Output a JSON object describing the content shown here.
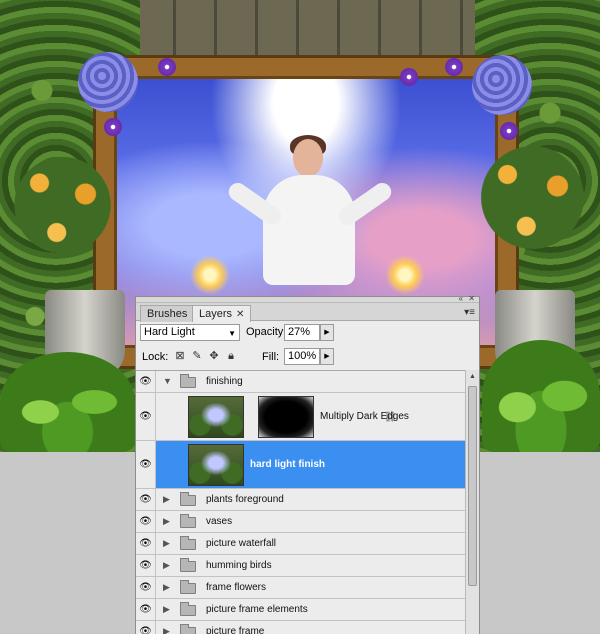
{
  "panel": {
    "tabs": [
      {
        "label": "Brushes",
        "active": false
      },
      {
        "label": "Layers",
        "active": true
      }
    ],
    "blend_mode": "Hard Light",
    "opacity_label": "Opacity:",
    "opacity_value": "27%",
    "lock_label": "Lock:",
    "fill_label": "Fill:",
    "fill_value": "100%"
  },
  "layers": [
    {
      "name": "finishing",
      "type": "group",
      "expanded": true
    },
    {
      "name": "Multiply Dark Edges",
      "type": "layer-with-mask"
    },
    {
      "name": "hard light finish",
      "type": "layer",
      "selected": true
    },
    {
      "name": "plants foreground",
      "type": "group"
    },
    {
      "name": "vases",
      "type": "group"
    },
    {
      "name": "picture waterfall",
      "type": "group"
    },
    {
      "name": "humming birds",
      "type": "group"
    },
    {
      "name": "frame flowers",
      "type": "group"
    },
    {
      "name": "picture frame elements",
      "type": "group"
    },
    {
      "name": "picture frame",
      "type": "group"
    }
  ],
  "colors": {
    "selection": "#3b8ff0",
    "panel_bg": "#ececec",
    "canvas_bg": "#c8c8c8"
  }
}
